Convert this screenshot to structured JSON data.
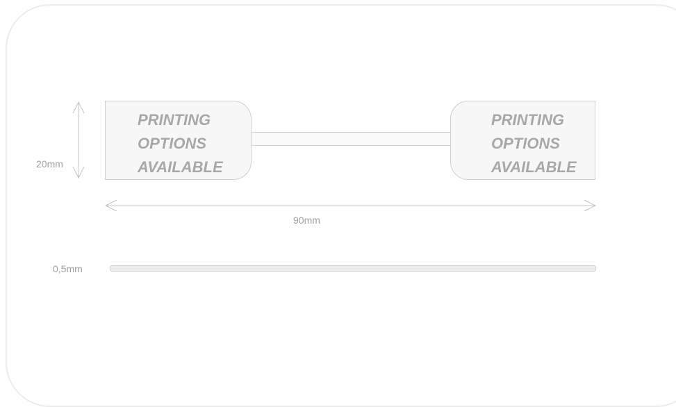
{
  "tags": {
    "left_text": [
      "PRINTING",
      "OPTIONS",
      "AVAILABLE"
    ],
    "right_text": [
      "PRINTING",
      "OPTIONS",
      "AVAILABLE"
    ]
  },
  "dimensions": {
    "height": "20mm",
    "width": "90mm",
    "thickness": "0,5mm"
  },
  "colors": {
    "outline": "#cfcfcf",
    "text": "#a8a8a8",
    "fill": "#f7f7f7"
  }
}
